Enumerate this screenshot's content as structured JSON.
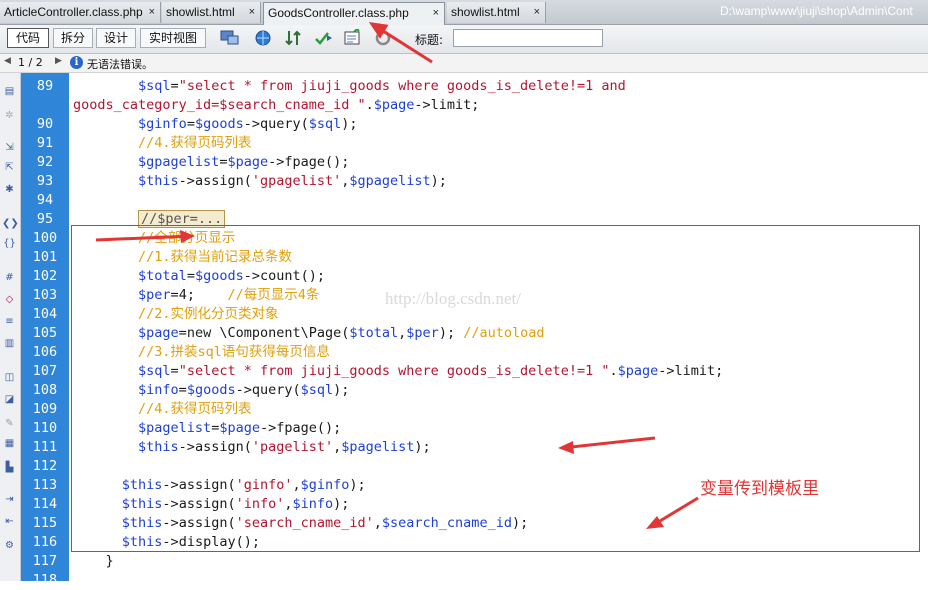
{
  "tabs": [
    {
      "label": "ArticleController.class.php",
      "close": "×",
      "active": false
    },
    {
      "label": "showlist.html",
      "close": "×",
      "active": false
    },
    {
      "label": "GoodsController.class.php",
      "close": "×",
      "active": true
    },
    {
      "label": "showlist.html",
      "close": "×",
      "active": false
    }
  ],
  "path_label": "D:\\wamp\\www\\jiuji\\shop\\Admin\\Cont",
  "toolbar": {
    "view_buttons": [
      "代码",
      "拆分",
      "设计",
      "实时视图"
    ],
    "title_label": "标题:",
    "title_value": "",
    "icons": [
      "multiscreen-icon",
      "globe-icon",
      "sort-icon",
      "validate-icon",
      "checklist-icon",
      "refresh-icon"
    ]
  },
  "status": {
    "page_indicator": "1 / 2",
    "message": "无语法错误。"
  },
  "editor": {
    "line_numbers": [
      "89",
      "",
      "90",
      "91",
      "92",
      "93",
      "94",
      "95",
      "100",
      "101",
      "102",
      "103",
      "104",
      "105",
      "106",
      "107",
      "108",
      "109",
      "110",
      "111",
      "112",
      "113",
      "114",
      "115",
      "116",
      "117",
      "118"
    ],
    "lines": [
      [
        [
          "i",
          "        "
        ],
        [
          "v",
          "$sql"
        ],
        [
          "op",
          "="
        ],
        [
          "str",
          "\"select * from jiuji_goods where goods_is_delete!=1 and"
        ]
      ],
      [
        [
          "str",
          "goods_category_id=$search_cname_id \""
        ],
        [
          "op",
          "."
        ],
        [
          "v",
          "$page"
        ],
        [
          "op",
          "->"
        ],
        [
          "fn",
          "limit;"
        ]
      ],
      [
        [
          "i",
          "        "
        ],
        [
          "v",
          "$ginfo"
        ],
        [
          "op",
          "="
        ],
        [
          "v",
          "$goods"
        ],
        [
          "op",
          "->"
        ],
        [
          "fn",
          "query("
        ],
        [
          "v",
          "$sql"
        ],
        [
          "fn",
          ");"
        ]
      ],
      [
        [
          "i",
          "        "
        ],
        [
          "cm",
          "//4.获得页码列表"
        ]
      ],
      [
        [
          "i",
          "        "
        ],
        [
          "v",
          "$gpagelist"
        ],
        [
          "op",
          "="
        ],
        [
          "v",
          "$page"
        ],
        [
          "op",
          "->"
        ],
        [
          "fn",
          "fpage();"
        ]
      ],
      [
        [
          "i",
          "        "
        ],
        [
          "v",
          "$this"
        ],
        [
          "op",
          "->"
        ],
        [
          "fn",
          "assign("
        ],
        [
          "str",
          "'gpagelist'"
        ],
        [
          "fn",
          ","
        ],
        [
          "v",
          "$gpagelist"
        ],
        [
          "fn",
          ");"
        ]
      ],
      [],
      [
        [
          "i",
          "        "
        ],
        [
          "collapsed",
          "//$per=..."
        ]
      ],
      [
        [
          "i",
          "        "
        ],
        [
          "cm",
          "//全部分页显示"
        ]
      ],
      [
        [
          "i",
          "        "
        ],
        [
          "cm",
          "//1.获得当前记录总条数"
        ]
      ],
      [
        [
          "i",
          "        "
        ],
        [
          "v",
          "$total"
        ],
        [
          "op",
          "="
        ],
        [
          "v",
          "$goods"
        ],
        [
          "op",
          "->"
        ],
        [
          "fn",
          "count();"
        ]
      ],
      [
        [
          "i",
          "        "
        ],
        [
          "v",
          "$per"
        ],
        [
          "op",
          "="
        ],
        [
          "fn",
          "4;    "
        ],
        [
          "cm",
          "//每页显示4条"
        ]
      ],
      [
        [
          "i",
          "        "
        ],
        [
          "cm",
          "//2.实例化分页类对象"
        ]
      ],
      [
        [
          "i",
          "        "
        ],
        [
          "v",
          "$page"
        ],
        [
          "op",
          "="
        ],
        [
          "kw",
          "new "
        ],
        [
          "fn",
          "\\Component\\Page("
        ],
        [
          "v",
          "$total"
        ],
        [
          "fn",
          ","
        ],
        [
          "v",
          "$per"
        ],
        [
          "fn",
          "); "
        ],
        [
          "cm",
          "//autoload"
        ]
      ],
      [
        [
          "i",
          "        "
        ],
        [
          "cm",
          "//3.拼装sql语句获得每页信息"
        ]
      ],
      [
        [
          "i",
          "        "
        ],
        [
          "v",
          "$sql"
        ],
        [
          "op",
          "="
        ],
        [
          "str",
          "\"select * from jiuji_goods where goods_is_delete!=1 \""
        ],
        [
          "op",
          "."
        ],
        [
          "v",
          "$page"
        ],
        [
          "op",
          "->"
        ],
        [
          "fn",
          "limit;"
        ]
      ],
      [
        [
          "i",
          "        "
        ],
        [
          "v",
          "$info"
        ],
        [
          "op",
          "="
        ],
        [
          "v",
          "$goods"
        ],
        [
          "op",
          "->"
        ],
        [
          "fn",
          "query("
        ],
        [
          "v",
          "$sql"
        ],
        [
          "fn",
          ");"
        ]
      ],
      [
        [
          "i",
          "        "
        ],
        [
          "cm",
          "//4.获得页码列表"
        ]
      ],
      [
        [
          "i",
          "        "
        ],
        [
          "v",
          "$pagelist"
        ],
        [
          "op",
          "="
        ],
        [
          "v",
          "$page"
        ],
        [
          "op",
          "->"
        ],
        [
          "fn",
          "fpage();"
        ]
      ],
      [
        [
          "i",
          "        "
        ],
        [
          "v",
          "$this"
        ],
        [
          "op",
          "->"
        ],
        [
          "fn",
          "assign("
        ],
        [
          "str",
          "'pagelist'"
        ],
        [
          "fn",
          ","
        ],
        [
          "v",
          "$pagelist"
        ],
        [
          "fn",
          ");"
        ]
      ],
      [],
      [
        [
          "i",
          "      "
        ],
        [
          "v",
          "$this"
        ],
        [
          "op",
          "->"
        ],
        [
          "fn",
          "assign("
        ],
        [
          "str",
          "'ginfo'"
        ],
        [
          "fn",
          ","
        ],
        [
          "v",
          "$ginfo"
        ],
        [
          "fn",
          ");"
        ]
      ],
      [
        [
          "i",
          "      "
        ],
        [
          "v",
          "$this"
        ],
        [
          "op",
          "->"
        ],
        [
          "fn",
          "assign("
        ],
        [
          "str",
          "'info'"
        ],
        [
          "fn",
          ","
        ],
        [
          "v",
          "$info"
        ],
        [
          "fn",
          ");"
        ]
      ],
      [
        [
          "i",
          "      "
        ],
        [
          "v",
          "$this"
        ],
        [
          "op",
          "->"
        ],
        [
          "fn",
          "assign("
        ],
        [
          "str",
          "'search_cname_id'"
        ],
        [
          "fn",
          ","
        ],
        [
          "v",
          "$search_cname_id"
        ],
        [
          "fn",
          ");"
        ]
      ],
      [
        [
          "i",
          "      "
        ],
        [
          "v",
          "$this"
        ],
        [
          "op",
          "->"
        ],
        [
          "fn",
          "display();"
        ]
      ],
      [
        [
          "i",
          "    "
        ],
        [
          "fn",
          "}"
        ]
      ],
      []
    ]
  },
  "watermark": "http://blog.csdn.net/",
  "annotation": "变量传到模板里",
  "colors": {
    "gutter": "#2f86d8",
    "variable": "#1e3fd8",
    "string": "#b4142f",
    "comment": "#e0a00c",
    "annotation_red": "#e23535"
  }
}
